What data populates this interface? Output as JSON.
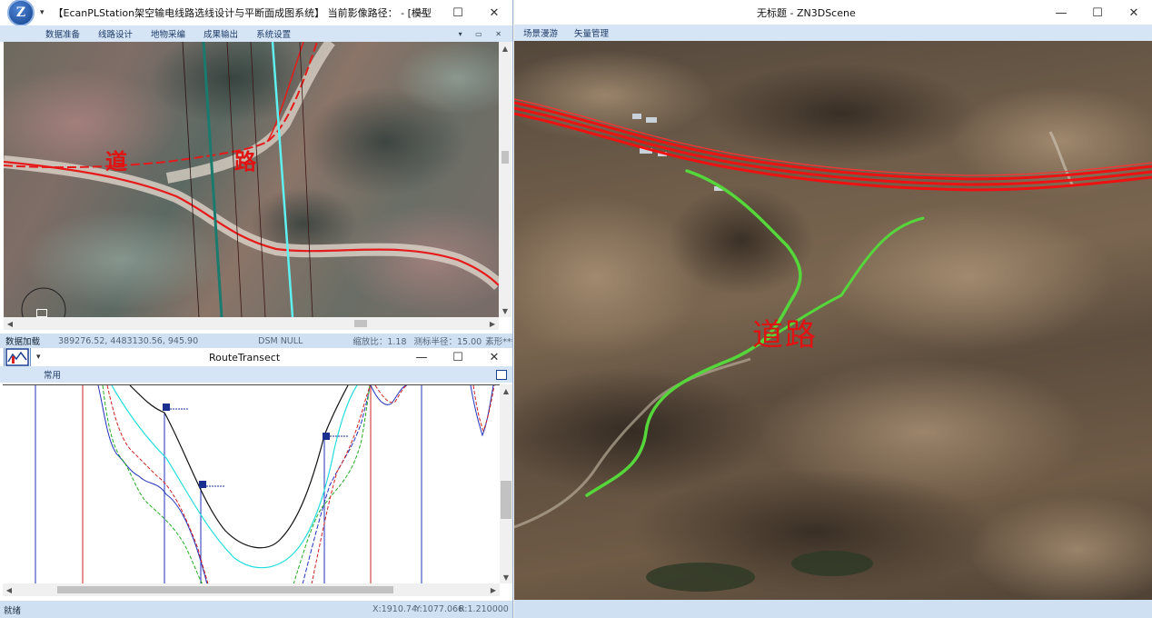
{
  "main_window": {
    "title": "【EcanPLStation架空输电线路选线设计与平断面成图系统】 当前影像路径： - [模型 - G:\\M...",
    "menu": [
      "数据准备",
      "线路设计",
      "地物采编",
      "成果输出",
      "系统设置"
    ],
    "map_labels": {
      "char1": "道",
      "char2": "路"
    },
    "status": {
      "load": "数据加载",
      "coords": "389276.52, 4483130.56,  945.90",
      "dsm": "DSM NULL",
      "scale": "缩放比：1.18",
      "radius": "测标半径：15.00",
      "pixel": "素形******"
    }
  },
  "transect_window": {
    "title": "RouteTransect",
    "menu": [
      "常用"
    ],
    "status": {
      "ready": "就绪",
      "x": "X:1910.74",
      "y": "Y:1077.066",
      "r": "R:1.210000"
    }
  },
  "scene_window": {
    "title": "无标题 - ZN3DScene",
    "menu": [
      "场景漫游",
      "矢量管理"
    ],
    "road_label": "道路"
  },
  "icons": {
    "minimize": "—",
    "maximize": "☐",
    "close": "✕",
    "pin": "▾"
  },
  "colors": {
    "powerline": "#ee1111",
    "road": "#55d63a",
    "menu_bg": "#d5e5f6"
  }
}
